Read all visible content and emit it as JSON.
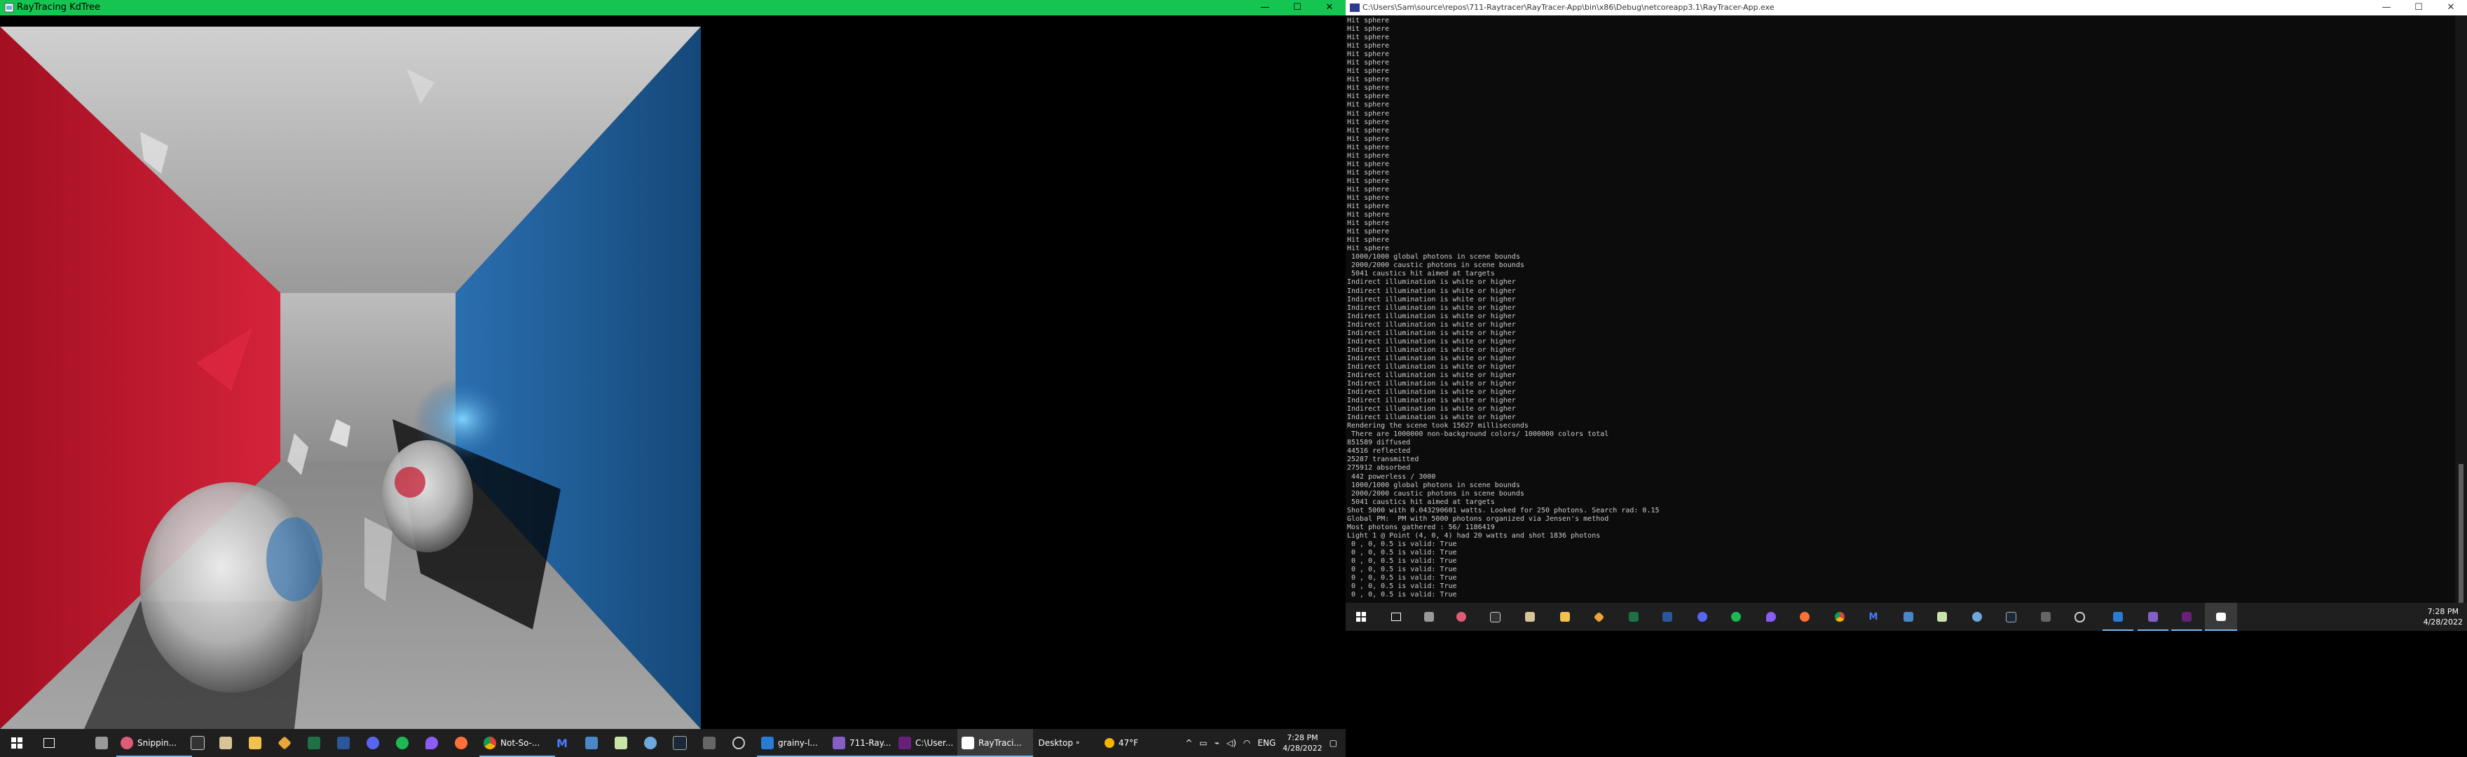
{
  "left_window": {
    "title": "RayTracing KdTree"
  },
  "right_window": {
    "title": "C:\\Users\\Sam\\source\\repos\\711-Raytracer\\RayTracer-App\\bin\\x86\\Debug\\netcoreapp3.1\\RayTracer-App.exe"
  },
  "window_controls": {
    "minimize": "—",
    "maximize": "☐",
    "close": "✕"
  },
  "console_lines": [
    "Hit sphere",
    "Hit sphere",
    "Hit sphere",
    "Hit sphere",
    "Hit sphere",
    "Hit sphere",
    "Hit sphere",
    "Hit sphere",
    "Hit sphere",
    "Hit sphere",
    "Hit sphere",
    "Hit sphere",
    "Hit sphere",
    "Hit sphere",
    "Hit sphere",
    "Hit sphere",
    "Hit sphere",
    "Hit sphere",
    "Hit sphere",
    "Hit sphere",
    "Hit sphere",
    "Hit sphere",
    "Hit sphere",
    "Hit sphere",
    "Hit sphere",
    "Hit sphere",
    "Hit sphere",
    "Hit sphere",
    " 1000/1000 global photons in scene bounds",
    " 2000/2000 caustic photons in scene bounds",
    " 5041 caustics hit aimed at targets",
    "Indirect illumination is white or higher",
    "Indirect illumination is white or higher",
    "Indirect illumination is white or higher",
    "Indirect illumination is white or higher",
    "Indirect illumination is white or higher",
    "Indirect illumination is white or higher",
    "Indirect illumination is white or higher",
    "Indirect illumination is white or higher",
    "Indirect illumination is white or higher",
    "Indirect illumination is white or higher",
    "Indirect illumination is white or higher",
    "Indirect illumination is white or higher",
    "Indirect illumination is white or higher",
    "Indirect illumination is white or higher",
    "Indirect illumination is white or higher",
    "Indirect illumination is white or higher",
    "Indirect illumination is white or higher",
    "Rendering the scene took 15627 milliseconds",
    " There are 1000000 non-background colors/ 1000000 colors total",
    "851589 diffused",
    "44516 reflected",
    "25287 transmitted",
    "275912 absorbed",
    " 442 powerless / 3000",
    " 1000/1000 global photons in scene bounds",
    " 2000/2000 caustic photons in scene bounds",
    " 5041 caustics hit aimed at targets",
    "Shot 5000 with 0.043290601 watts. Looked for 250 photons. Search rad: 0.15",
    "Global PM:  PM with 5000 photons organized via Jensen's method",
    "Most photons gathered : 56/ 1186419",
    "Light 1 @ Point (4, 0, 4) had 20 watts and shot 1836 photons",
    " 0 , 0, 0.5 is valid: True",
    " 0 , 0, 0.5 is valid: True",
    " 0 , 0, 0.5 is valid: True",
    " 0 , 0, 0.5 is valid: True",
    " 0 , 0, 0.5 is valid: True",
    " 0 , 0, 0.5 is valid: True",
    " 0 , 0, 0.5 is valid: True"
  ],
  "left_taskbar": {
    "apps": [
      "Snippin...",
      "Not-So-...",
      "grainy-l...",
      "711-Ray...",
      "C:\\User...",
      "RayTraci..."
    ],
    "desktop_label": "Desktop",
    "weather": "47°F",
    "language": "ENG",
    "time": "7:28 PM",
    "date": "4/28/2022"
  },
  "right_taskbar": {
    "time": "7:28 PM",
    "date": "4/28/2022"
  },
  "colors": {
    "left_titlebar": "#16c451",
    "taskbar": "#1f1f1f",
    "red_wall": "#c5132a",
    "blue_wall": "#1f5e9c",
    "floor": "#9b9b9b",
    "console_bg": "#0c0c0c",
    "console_text": "#cccccc"
  }
}
